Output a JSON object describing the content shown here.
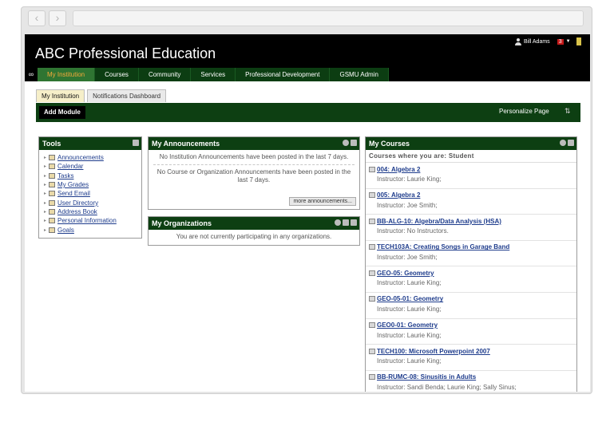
{
  "header": {
    "title": "ABC Professional Education",
    "user_name": "Bill Adams",
    "notification_count": "3"
  },
  "nav_tabs": [
    "My Institution",
    "Courses",
    "Community",
    "Services",
    "Professional Development",
    "GSMU Admin"
  ],
  "sub_tabs": [
    "My Institution",
    "Notifications Dashboard"
  ],
  "module_bar": {
    "add_module": "Add Module",
    "personalize": "Personalize Page"
  },
  "tools": {
    "title": "Tools",
    "items": [
      "Announcements",
      "Calendar",
      "Tasks",
      "My Grades",
      "Send Email",
      "User Directory",
      "Address Book",
      "Personal Information",
      "Goals"
    ]
  },
  "announcements": {
    "title": "My Announcements",
    "institution_msg": "No Institution Announcements have been posted in the last 7 days.",
    "course_msg": "No Course or Organization Announcements have been posted in the last 7 days.",
    "more_label": "more announcements..."
  },
  "organizations": {
    "title": "My Organizations",
    "message": "You are not currently participating in any organizations."
  },
  "courses": {
    "title": "My Courses",
    "subtitle": "Courses where you are: Student",
    "items": [
      {
        "name": "004: Algebra 2",
        "instructor": "Instructor: Laurie King;"
      },
      {
        "name": "005: Algebra 2",
        "instructor": "Instructor: Joe Smith;"
      },
      {
        "name": "BB-ALG-10: Algebra/Data Analysis (HSA)",
        "instructor": "Instructor:       No Instructors."
      },
      {
        "name": "TECH103A: Creating Songs in Garage Band",
        "instructor": "Instructor: Joe Smith;"
      },
      {
        "name": "GEO-05: Geometry",
        "instructor": "Instructor: Laurie King;"
      },
      {
        "name": "GEO-05-01: Geometry",
        "instructor": "Instructor: Laurie King;"
      },
      {
        "name": "GEO0-01: Geometry",
        "instructor": "Instructor: Laurie King;"
      },
      {
        "name": "TECH100: Microsoft Powerpoint 2007",
        "instructor": "Instructor: Laurie King;"
      },
      {
        "name": "BB-RUMC-08: Sinusitis in Adults",
        "instructor": "Instructor: Sandi Benda;  Laurie King;  Sally Sinus;"
      }
    ]
  }
}
